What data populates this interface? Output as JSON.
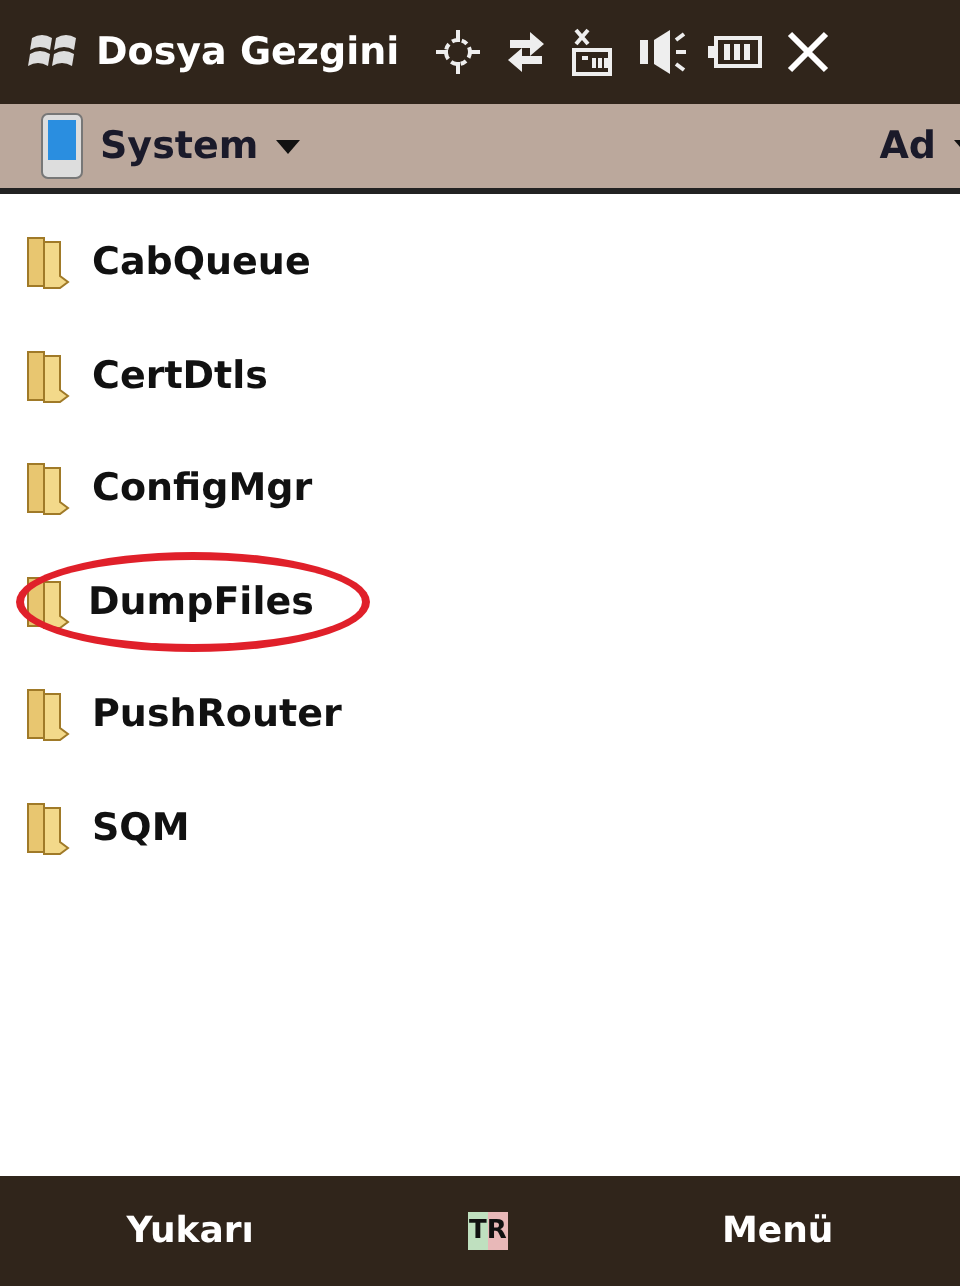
{
  "title_bar": {
    "title": "Dosya Gezgini"
  },
  "location_bar": {
    "location": "System",
    "sort": "Ad"
  },
  "folders": [
    {
      "name": "CabQueue",
      "circled": false
    },
    {
      "name": "CertDtls",
      "circled": false
    },
    {
      "name": "ConfigMgr",
      "circled": false
    },
    {
      "name": "DumpFiles",
      "circled": true
    },
    {
      "name": "PushRouter",
      "circled": false
    },
    {
      "name": "SQM",
      "circled": false
    }
  ],
  "soft_keys": {
    "left": "Yukarı",
    "input_language": "TR",
    "right": "Menü"
  }
}
